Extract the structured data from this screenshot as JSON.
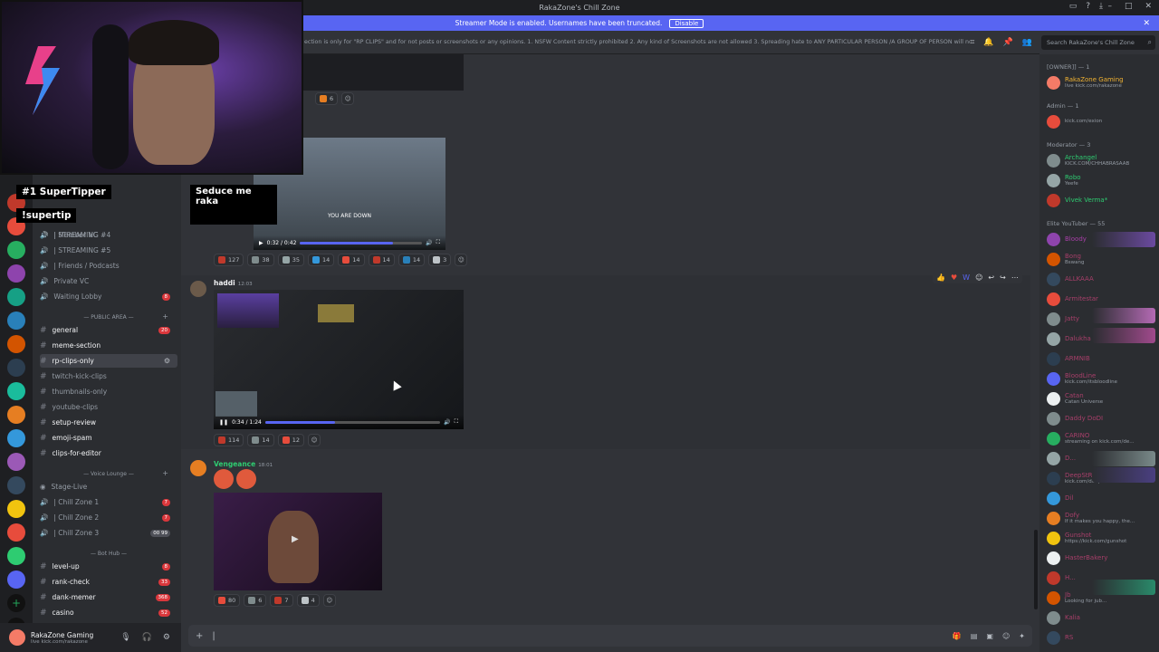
{
  "window": {
    "title": "RakaZone's Chill Zone"
  },
  "banner": {
    "text": "Streamer Mode is enabled. Usernames have been truncated.",
    "button": "Disable"
  },
  "topic": {
    "text": "ection is only for \"RP CLIPS\" and for not posts or screenshots or any opinions. 1. NSFW Content strictly prohibited 2. Any kind of Screenshots are not allowed 3. Spreading hate to ANY PARTICULAR PERSON /A GROUP OF PERSON will not be t..."
  },
  "search": {
    "placeholder": "Search RakaZone's Chill Zone"
  },
  "overlay": {
    "supertipper": "#1 SuperTipper",
    "command": "!supertip",
    "message": "Seduce me raka"
  },
  "guild_badges": [
    "62",
    "879",
    "24k",
    "1k",
    "16k",
    "8k",
    "878",
    "977",
    "66k",
    "26k",
    "84k",
    "6k",
    "9k",
    "845",
    "834"
  ],
  "channels": {
    "voice_top": [
      "| Member VC",
      "| STREAMING #4",
      "| STREAMING #5",
      "| Friends / Podcasts",
      "Private VC",
      "Waiting Lobby"
    ],
    "waiting_badge": "8",
    "public_area": "PUBLIC AREA",
    "public": [
      {
        "name": "general",
        "badge": "20"
      },
      {
        "name": "meme-section",
        "badge": ""
      },
      {
        "name": "rp-clips-only",
        "badge": ""
      },
      {
        "name": "twitch-kick-clips",
        "badge": ""
      },
      {
        "name": "thumbnails-only",
        "badge": ""
      },
      {
        "name": "youtube-clips",
        "badge": ""
      },
      {
        "name": "setup-review",
        "badge": ""
      },
      {
        "name": "emoji-spam",
        "badge": ""
      },
      {
        "name": "clips-for-editor",
        "badge": ""
      }
    ],
    "voice_lounge": "Voice Lounge",
    "lounge": [
      {
        "name": "Stage-Live",
        "badge": ""
      },
      {
        "name": "| Chill Zone 1",
        "badge": "7"
      },
      {
        "name": "| Chill Zone 2",
        "badge": "7"
      },
      {
        "name": "| Chill Zone 3",
        "badge": "00 99"
      }
    ],
    "bot_hub": "Bot Hub",
    "bots": [
      {
        "name": "level-up",
        "badge": "8"
      },
      {
        "name": "rank-check",
        "badge": "33"
      },
      {
        "name": "dank-memer",
        "badge": "368"
      },
      {
        "name": "casino",
        "badge": "52"
      }
    ]
  },
  "user": {
    "name": "RakaZone Gaming",
    "status": "live kick.com/rakazone"
  },
  "messages": {
    "m1": {
      "reactions": [
        "6"
      ]
    },
    "m2": {
      "time_label": "0:32 / 0:42",
      "overlay_text": "YOU ARE DOWN",
      "progress": 0.76,
      "reactions": [
        "127",
        "38",
        "35",
        "14",
        "14",
        "14",
        "14",
        "3"
      ]
    },
    "m3": {
      "author": "haddi",
      "time": "12:03",
      "time_label": "0:34 / 1:24",
      "progress": 0.4,
      "reactions": [
        "114",
        "14",
        "12"
      ]
    },
    "m4": {
      "author": "Vengeance",
      "time": "18:01",
      "reactions": [
        "80",
        "6",
        "7",
        "4"
      ]
    }
  },
  "members": {
    "owner_cat": "[OWNER]] — 1",
    "owner": {
      "name": "RakaZone Gaming",
      "status": "live kick.com/rakazone"
    },
    "admin_cat": "Admin — 1",
    "admin": {
      "name": "",
      "status": "kick.com/exion"
    },
    "mod_cat": "Moderator — 3",
    "mods": [
      {
        "name": "Archangel",
        "status": "KICK.COM/CHHABRASAAB"
      },
      {
        "name": "Robo",
        "status": "Yeefe"
      },
      {
        "name": "Vivek Verma*",
        "status": ""
      }
    ],
    "yt_cat": "Elite YouTuber — 55",
    "yt": [
      {
        "name": "Bloody",
        "status": ""
      },
      {
        "name": "Bong",
        "status": "Bswang"
      },
      {
        "name": "ALLKAAA",
        "status": ""
      },
      {
        "name": "Armitestar",
        "status": ""
      },
      {
        "name": "Jatty",
        "status": ""
      },
      {
        "name": "Dalukha",
        "status": ""
      },
      {
        "name": "ARMNIB",
        "status": ""
      },
      {
        "name": "BloodLine",
        "status": "kick.com/itsbloodline"
      },
      {
        "name": "Catan",
        "status": "Catan Universe"
      },
      {
        "name": "Daddy DoDI",
        "status": ""
      },
      {
        "name": "CARINO",
        "status": "streaming on kick.com/de..."
      },
      {
        "name": "D...",
        "status": ""
      },
      {
        "name": "DeepStR",
        "status": "kick.com/deepsYK"
      },
      {
        "name": "Dil",
        "status": ""
      },
      {
        "name": "Dofy",
        "status": "If it makes you happy, the..."
      },
      {
        "name": "Gunshot",
        "status": "https://kick.com/gunshot"
      },
      {
        "name": "HasterBakery",
        "status": ""
      },
      {
        "name": "H...",
        "status": ""
      },
      {
        "name": "Jb",
        "status": "Looking for jub..."
      },
      {
        "name": "Kalia",
        "status": ""
      },
      {
        "name": "RS",
        "status": ""
      }
    ]
  },
  "colors": {
    "accent": "#5865f2",
    "bg": "#313338",
    "sidebar": "#2b2d31",
    "rail": "#1e1f22"
  }
}
